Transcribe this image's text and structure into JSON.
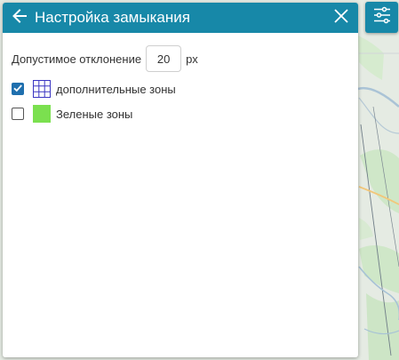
{
  "panel": {
    "title": "Настройка замыкания"
  },
  "tolerance": {
    "label": "Допустимое отклонение",
    "value": "20",
    "unit": "px"
  },
  "layers": [
    {
      "label": "дополнительные зоны",
      "checked": true,
      "swatch": "grid",
      "color": "#3b36c2"
    },
    {
      "label": "Зеленые зоны",
      "checked": false,
      "swatch": "solid",
      "color": "#7be04f"
    }
  ],
  "icons": {
    "back": "arrow-left-icon",
    "close": "close-icon",
    "tool": "sliders-icon",
    "check": "check-icon"
  },
  "colors": {
    "accent": "#1788a8",
    "checkbox": "#1f6fae"
  }
}
